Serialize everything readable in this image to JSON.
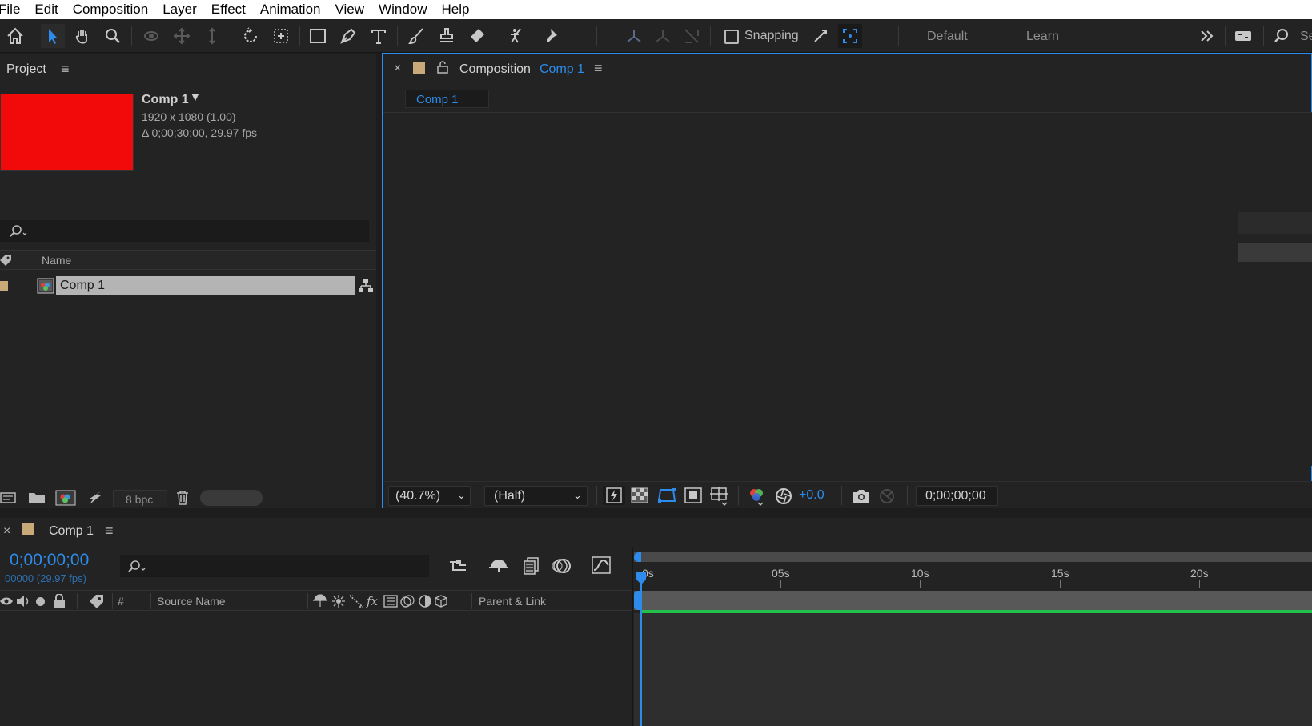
{
  "menu": [
    "File",
    "Edit",
    "Composition",
    "Layer",
    "Effect",
    "Animation",
    "View",
    "Window",
    "Help"
  ],
  "toolbar": {
    "snapping_label": "Snapping",
    "workspaces": [
      "Default",
      "Learn"
    ],
    "search_placeholder": "Se"
  },
  "project": {
    "title": "Project",
    "preview_color": "#f20a0a",
    "comp_name": "Comp 1",
    "comp_resolution": "1920 x 1080 (1.00)",
    "comp_duration": "Δ 0;00;30;00, 29.97 fps",
    "column_name": "Name",
    "items": [
      {
        "name": "Comp 1"
      }
    ],
    "bpc": "8 bpc"
  },
  "composition": {
    "tab_prefix": "Composition",
    "tab_name": "Comp 1",
    "flow_tab": "Comp 1",
    "zoom": "(40.7%)",
    "resolution": "(Half)",
    "exposure": "+0.0",
    "timecode": "0;00;00;00"
  },
  "timeline": {
    "tab_name": "Comp 1",
    "timecode": "0;00;00;00",
    "frame_info": "00000 (29.97 fps)",
    "col_hash": "#",
    "col_source": "Source Name",
    "col_parent": "Parent & Link",
    "ruler": [
      "0s",
      "05s",
      "10s",
      "15s",
      "20s"
    ]
  },
  "colors": {
    "accent": "#2d8ceb",
    "work_area_green": "#22c24a",
    "label_tan": "#c9a978"
  }
}
